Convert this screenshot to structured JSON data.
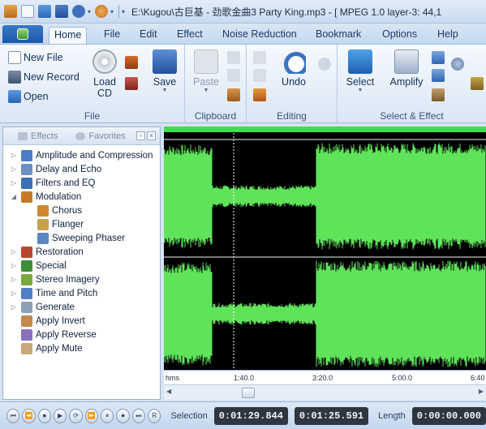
{
  "titlebar": {
    "text": "E:\\Kugou\\古巨基 - 劲歌金曲3 Party King.mp3 - [ MPEG 1.0 layer-3: 44,1"
  },
  "tabs": [
    "Home",
    "File",
    "Edit",
    "Effect",
    "Noise Reduction",
    "Bookmark",
    "Options",
    "Help"
  ],
  "ribbon": {
    "file": {
      "new_file": "New File",
      "new_record": "New Record",
      "open": "Open",
      "load_cd": "Load CD",
      "save": "Save",
      "label": "File"
    },
    "clipboard": {
      "paste": "Paste",
      "label": "Clipboard"
    },
    "editing": {
      "undo": "Undo",
      "label": "Editing"
    },
    "select_effect": {
      "select": "Select",
      "amplify": "Amplify",
      "label": "Select & Effect"
    }
  },
  "panel": {
    "tab_effects": "Effects",
    "tab_favorites": "Favorites",
    "tree": [
      {
        "label": "Amplitude and Compression",
        "expander": "▷",
        "color": "#4a7ec9"
      },
      {
        "label": "Delay and Echo",
        "expander": "▷",
        "color": "#6b8fc0"
      },
      {
        "label": "Filters and EQ",
        "expander": "▷",
        "color": "#3b6fb6"
      },
      {
        "label": "Modulation",
        "expander": "◢",
        "color": "#c77b2a"
      },
      {
        "label": "Chorus",
        "color": "#d3882f"
      },
      {
        "label": "Flanger",
        "color": "#c9a24a"
      },
      {
        "label": "Sweeping Phaser",
        "color": "#5b86c4"
      },
      {
        "label": "Restoration",
        "expander": "▷",
        "color": "#b5472f"
      },
      {
        "label": "Special",
        "expander": "▷",
        "color": "#3e8c3a"
      },
      {
        "label": "Stereo Imagery",
        "expander": "▷",
        "color": "#7aa83c"
      },
      {
        "label": "Time and Pitch",
        "expander": "▷",
        "color": "#4f7fc7"
      },
      {
        "label": "Generate",
        "expander": "▷",
        "color": "#8e9fb7"
      },
      {
        "label": "Apply Invert",
        "color": "#c3894d"
      },
      {
        "label": "Apply Reverse",
        "color": "#8d6fbf"
      },
      {
        "label": "Apply Mute",
        "color": "#c9a77a"
      }
    ]
  },
  "ruler": {
    "labels": [
      "hms",
      "1:40.0",
      "3:20.0",
      "5:00.0",
      "6:40"
    ]
  },
  "transport": {
    "buttons": [
      "⏮",
      "⏪",
      "⏹",
      "▶",
      "⟳",
      "⏩",
      "⏸",
      "⏺",
      "⏭",
      "R"
    ],
    "selection_label": "Selection",
    "selection_start": "0:01:29.844",
    "selection_end": "0:01:25.591",
    "length_label": "Length",
    "length_value": "0:00:00.000"
  },
  "colors": {
    "wave": "#5fe35a",
    "accent": "#1c58a8"
  }
}
